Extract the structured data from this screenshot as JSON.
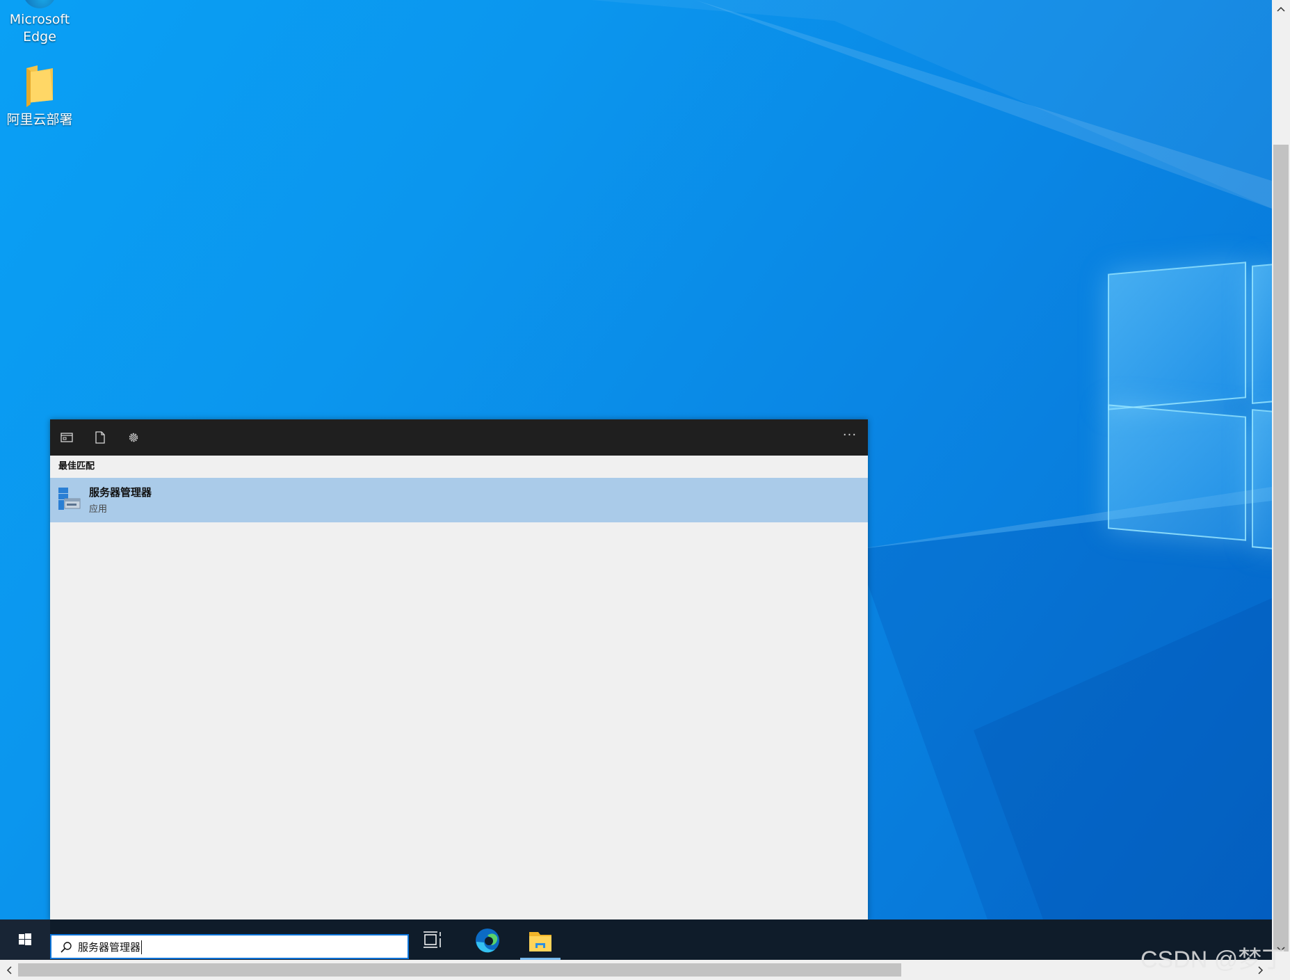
{
  "desktop": {
    "icons": [
      {
        "label": "Microsoft Edge",
        "icon": "edge-icon"
      },
      {
        "label": "阿里云部署",
        "icon": "folder-icon"
      }
    ]
  },
  "flyout": {
    "tabs": [
      {
        "name": "apps",
        "icon": "apps-icon"
      },
      {
        "name": "documents",
        "icon": "document-icon"
      },
      {
        "name": "settings",
        "icon": "gear-icon"
      }
    ],
    "more_label": "···",
    "section_label": "最佳匹配",
    "best_match": {
      "title": "服务器管理器",
      "subtitle": "应用",
      "icon": "server-manager-icon"
    }
  },
  "taskbar": {
    "search_value": "服务器管理器",
    "items": [
      "task-view-icon",
      "edge-icon",
      "file-explorer-icon"
    ],
    "active_item": "file-explorer-icon"
  },
  "watermark": "CSDN @梦丁",
  "colors": {
    "taskbar": "#0f1c2a",
    "selection": "#aacbe9",
    "accent": "#0a74da"
  }
}
